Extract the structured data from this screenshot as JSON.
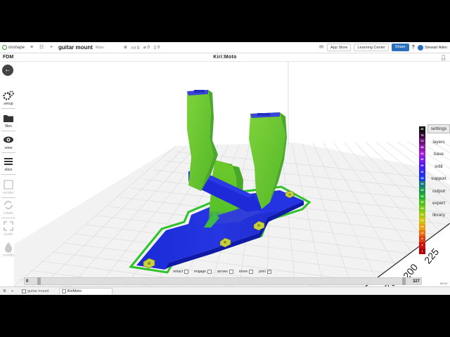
{
  "onshape": {
    "logo_text": "onshape",
    "document_name": "guitar mount",
    "branch": "Main",
    "likes": "0",
    "links": "0",
    "copies": "0",
    "app_store": "App Store",
    "learning_center": "Learning Center",
    "share": "Share",
    "help": "?",
    "user": "Stewart Allen"
  },
  "kiri": {
    "mode": "FDM",
    "title": "Kiri:Moto"
  },
  "left_tools": [
    {
      "label": "setup",
      "icon": "gears-icon",
      "enabled": true
    },
    {
      "label": "files",
      "icon": "folder-icon",
      "enabled": true
    },
    {
      "label": "view",
      "icon": "eye-icon",
      "enabled": true
    },
    {
      "label": "slice",
      "icon": "layers-icon",
      "enabled": true
    },
    {
      "label": "render",
      "icon": "square-icon",
      "enabled": false
    },
    {
      "label": "rotate",
      "icon": "rotate-icon",
      "enabled": false
    },
    {
      "label": "scale",
      "icon": "scale-icon",
      "enabled": false
    },
    {
      "label": "modify",
      "icon": "drop-icon",
      "enabled": false
    }
  ],
  "legend": [
    {
      "label": "80",
      "color": "#111111"
    },
    {
      "label": "76",
      "color": "#3a0a3a"
    },
    {
      "label": "72",
      "color": "#6a147a"
    },
    {
      "label": "68",
      "color": "#8a1cb0"
    },
    {
      "label": "64",
      "color": "#a61cd8"
    },
    {
      "label": "60",
      "color": "#7a1cf0"
    },
    {
      "label": "56",
      "color": "#4a1ef2"
    },
    {
      "label": "52",
      "color": "#2a2af0"
    },
    {
      "label": "48",
      "color": "#1c3cea"
    },
    {
      "label": "44",
      "color": "#1a7a7a"
    },
    {
      "label": "40",
      "color": "#1a9a4a"
    },
    {
      "label": "36",
      "color": "#22b030"
    },
    {
      "label": "32",
      "color": "#54c020"
    },
    {
      "label": "28",
      "color": "#7ac818"
    },
    {
      "label": "24",
      "color": "#a8c810"
    },
    {
      "label": "20",
      "color": "#d0c010"
    },
    {
      "label": "16",
      "color": "#e8a010"
    },
    {
      "label": "12",
      "color": "#e87010"
    },
    {
      "label": "8",
      "color": "#e04010"
    },
    {
      "label": "4",
      "color": "#d01010"
    },
    {
      "label": "1",
      "color": "#b00000"
    }
  ],
  "right_menu": [
    "settings",
    "layers",
    "base",
    "infill",
    "support",
    "output",
    "expert",
    "library"
  ],
  "active_menu": "settings",
  "grid_labels": [
    "225",
    "200",
    "175"
  ],
  "view_checks": [
    {
      "label": "retract",
      "checked": false
    },
    {
      "label": "engage",
      "checked": false
    },
    {
      "label": "arrows",
      "checked": false
    },
    {
      "label": "move",
      "checked": false
    },
    {
      "label": "print",
      "checked": true
    }
  ],
  "slider": {
    "low": "0",
    "high": "327"
  },
  "fps": "60.04",
  "bottom_tabs": [
    {
      "label": "guitar mount",
      "active": false
    },
    {
      "label": "KiriMoto",
      "active": true
    }
  ]
}
